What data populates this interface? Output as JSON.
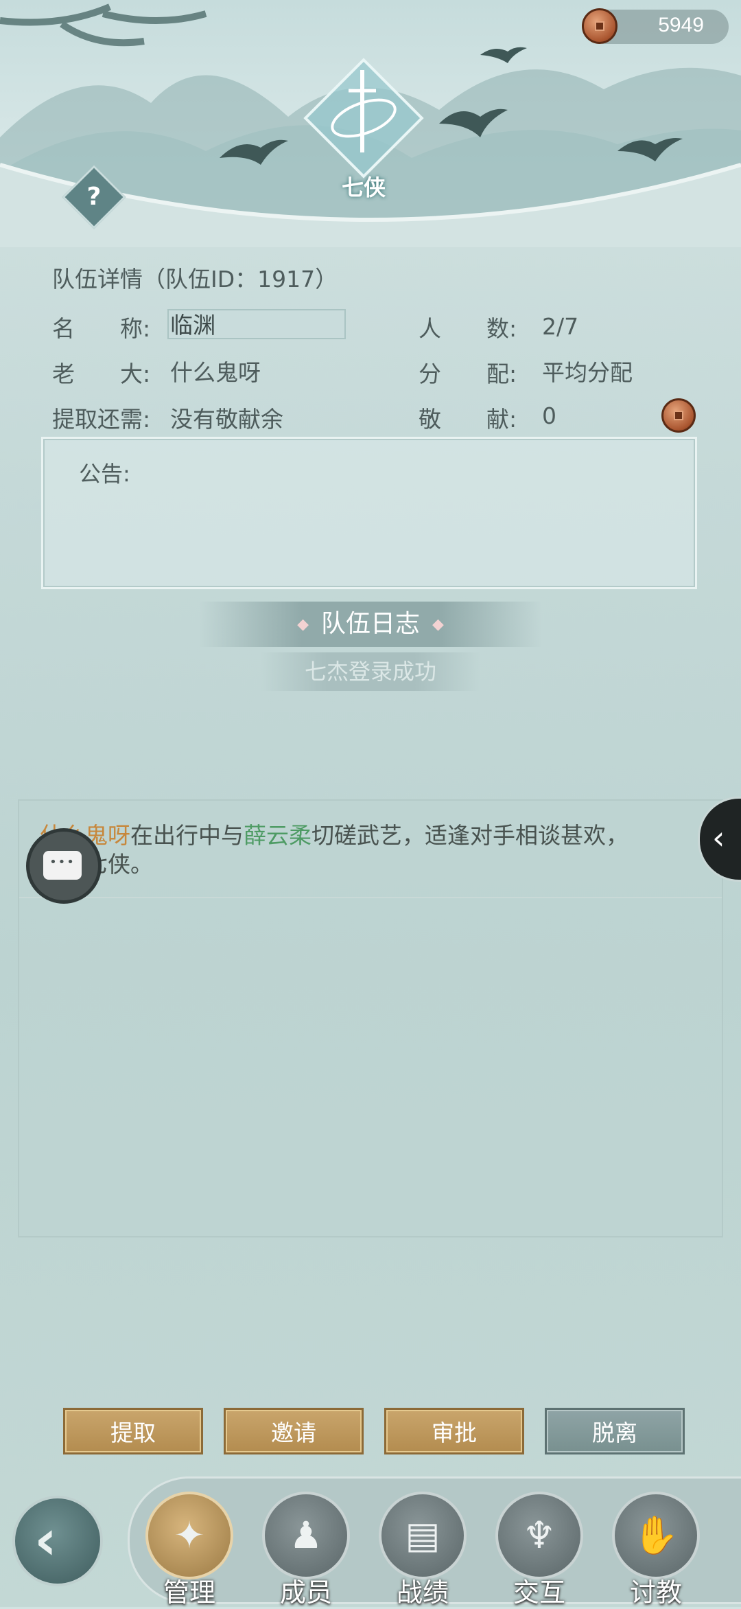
{
  "currency": {
    "icon": "copper-coin-icon",
    "value": "5949"
  },
  "emblem": {
    "title": "七侠"
  },
  "details": {
    "section_title": "队伍详情（队伍ID：1917）",
    "name_label": "名　　称:",
    "name_value": "临渊",
    "members_label": "人　　数:",
    "members_value": "2/7",
    "leader_label": "老　　大:",
    "leader_value": "什么鬼呀",
    "distribution_label": "分　　配:",
    "distribution_value": "平均分配",
    "withdraw_label": "提取还需:",
    "withdraw_value": "没有敬献余",
    "contribution_label": "敬　　献:",
    "contribution_value": "0"
  },
  "notice": {
    "label": "公告:"
  },
  "log": {
    "title": "队伍日志",
    "sub": "七杰登录成功"
  },
  "chat": {
    "name1": "什么鬼呀",
    "text1": "在出行中与",
    "name2": "薛云柔",
    "text2": "切磋武艺，适逢对手相谈甚欢，",
    "text3": "江湖七侠。"
  },
  "buttons": {
    "withdraw": "提取",
    "invite": "邀请",
    "approve": "审批",
    "leave": "脱离"
  },
  "nav": {
    "manage": "管理",
    "members": "成员",
    "records": "战绩",
    "interact": "交互",
    "instruct": "讨教"
  },
  "colors": {
    "gold_button": "#b99556",
    "grey_button": "#7f9696",
    "name_orange": "#c7873b",
    "name_green": "#4e9b64"
  }
}
